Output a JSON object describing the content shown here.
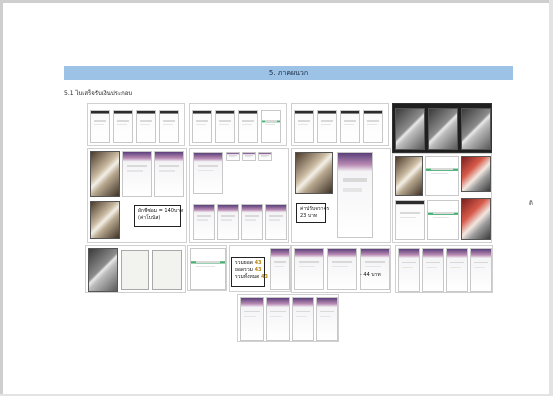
{
  "document": {
    "section_title": "5. ภาคผนวก",
    "subsection_title": "5.1 ไบเสร็จรับเงินประกอบ",
    "side_mark": "ดิ"
  },
  "annotations": {
    "note_1_line1": "ผักชีซ่อม  =  140บาท",
    "note_1_line2": "(ค่าโบนัส)",
    "note_2_line1": "ค่าปรับจราจร",
    "note_2_line2": "23  บาท",
    "note_3_label1": "รวมยอด",
    "note_3_value1": "43",
    "note_3_label2": "ยอดรวม",
    "note_3_value2": "43",
    "note_3_label3": "รวมทั้งหมด",
    "note_3_value3": "43",
    "note_4": "- 44  บาท"
  }
}
